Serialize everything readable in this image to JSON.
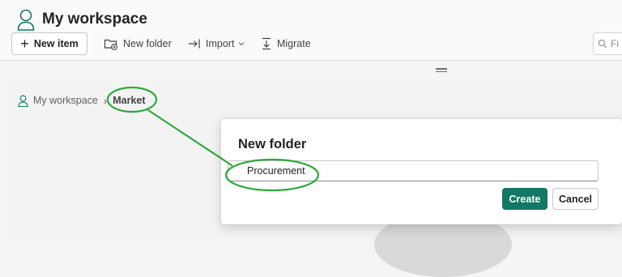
{
  "header": {
    "workspace_title": "My workspace",
    "workspace_icon": "person-icon"
  },
  "toolbar": {
    "new_item_label": "New item",
    "new_folder_label": "New folder",
    "import_label": "Import",
    "migrate_label": "Migrate",
    "search_placeholder": "Fi"
  },
  "breadcrumb": {
    "root_label": "My workspace",
    "current_label": "Market"
  },
  "dialog": {
    "title": "New folder",
    "input_value": "Procurement",
    "create_label": "Create",
    "cancel_label": "Cancel"
  },
  "colors": {
    "primary": "#117865",
    "annotation": "#2eaa3c"
  }
}
